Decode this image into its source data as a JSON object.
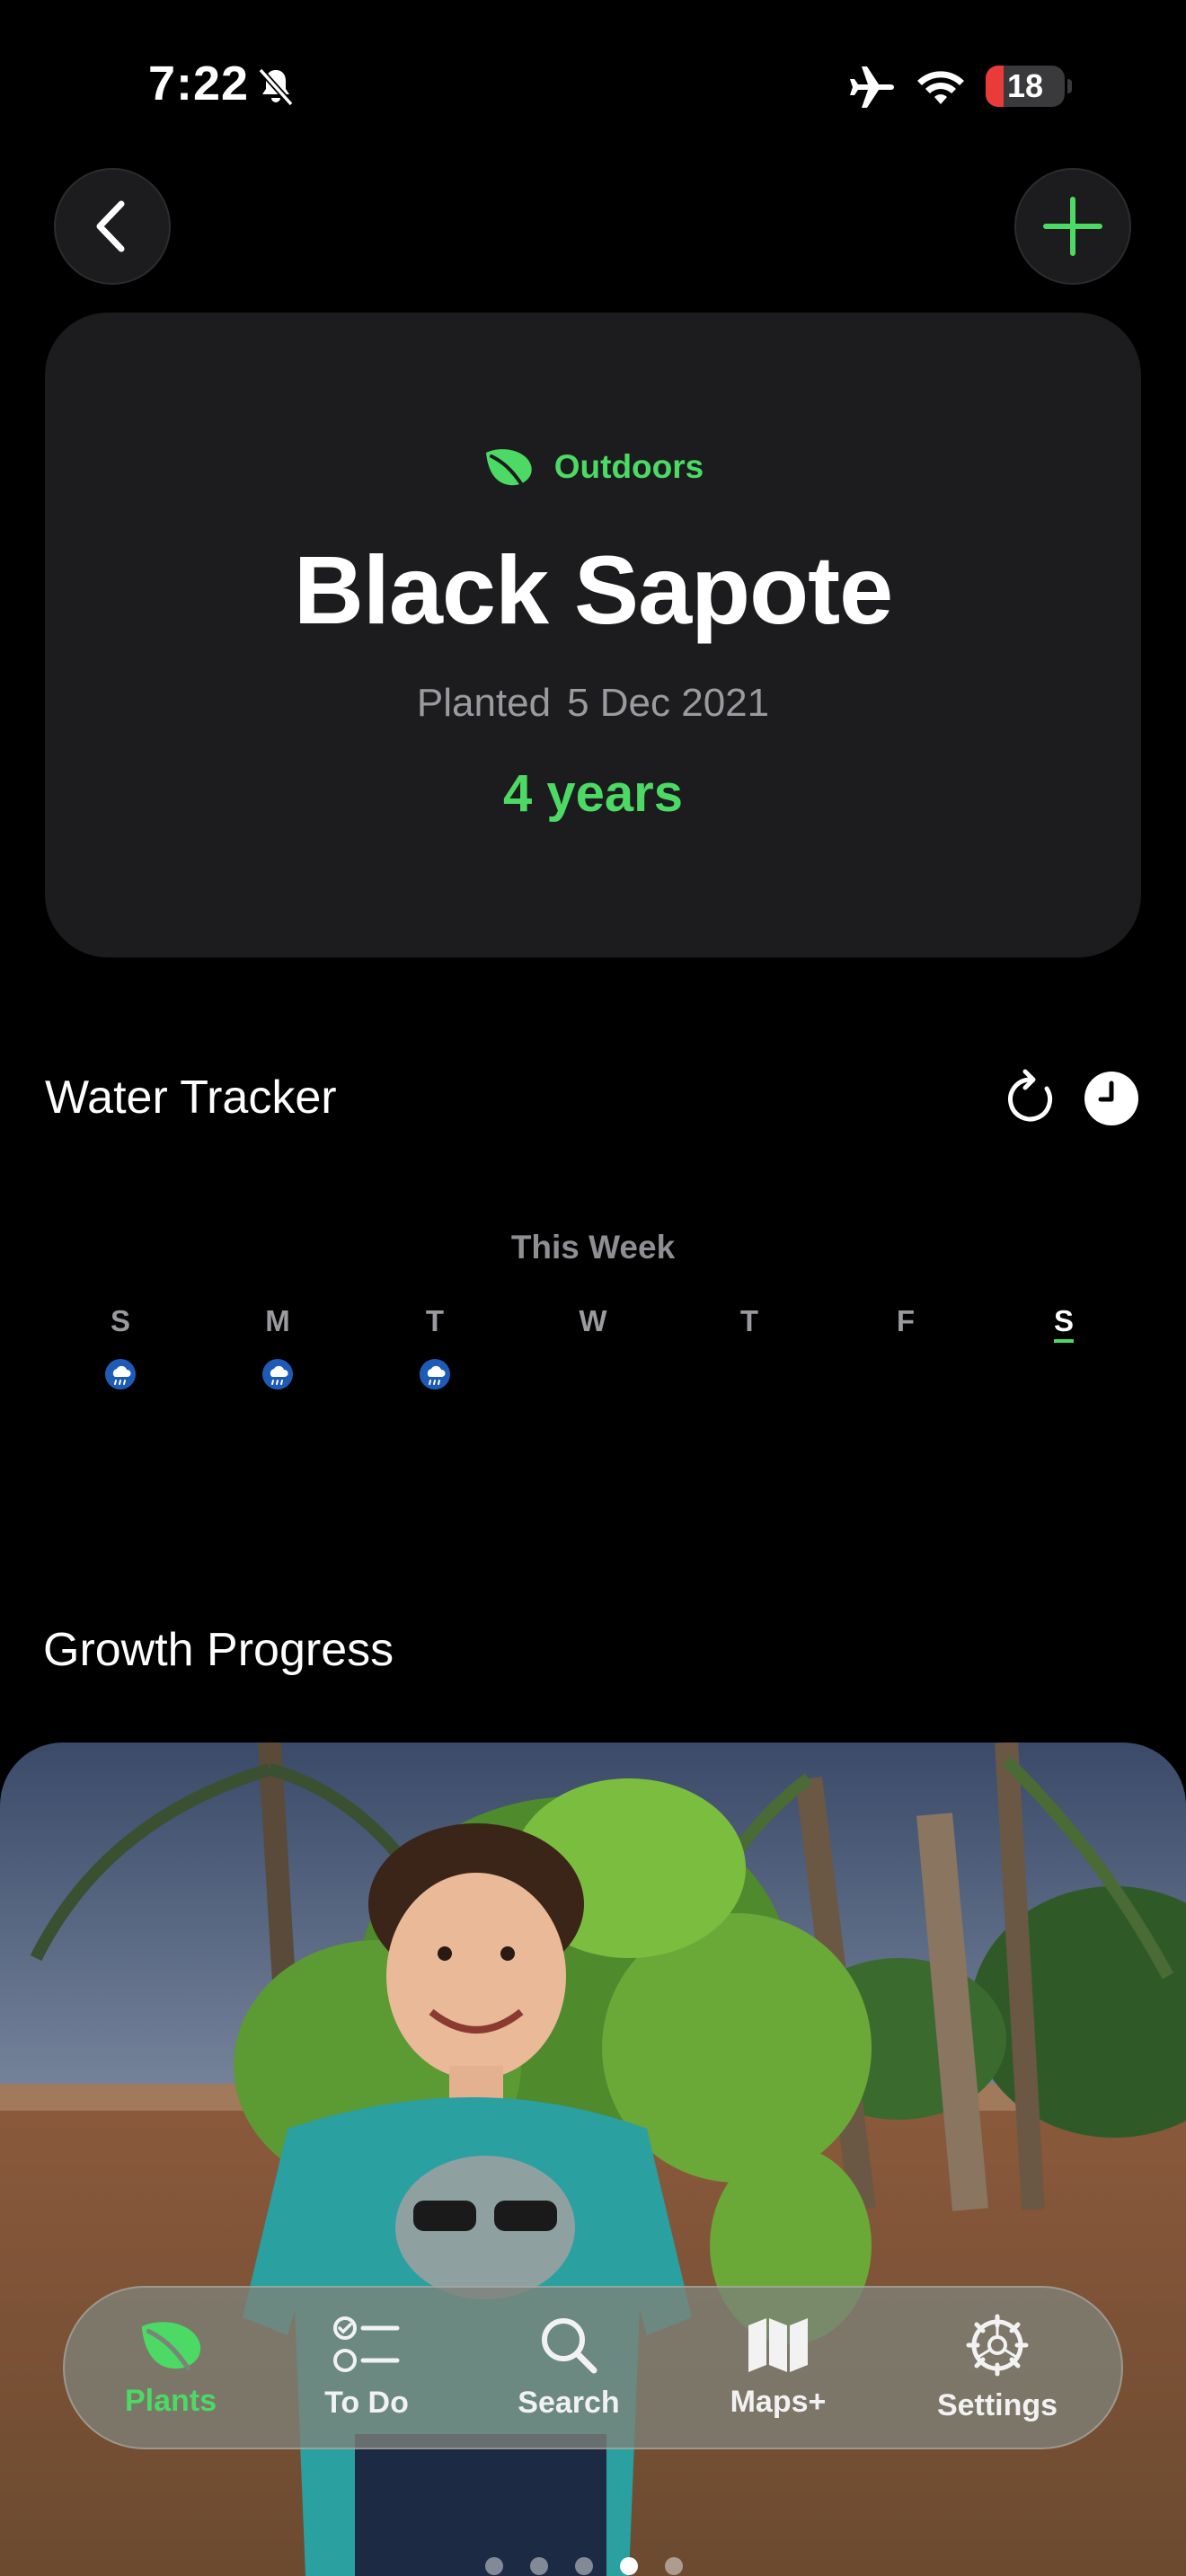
{
  "status_bar": {
    "time": "7:22",
    "battery": "18"
  },
  "header": {
    "location": "Outdoors",
    "plant_name": "Black Sapote",
    "planted_label": "Planted",
    "planted_date": "5 Dec 2021",
    "age": "4 years"
  },
  "water_tracker": {
    "title": "Water Tracker",
    "week_label": "This Week",
    "days": [
      "S",
      "M",
      "T",
      "W",
      "T",
      "F",
      "S"
    ],
    "rain_days": [
      "S",
      "M",
      "T"
    ],
    "today": "S"
  },
  "growth": {
    "title": "Growth Progress"
  },
  "tabbar": {
    "plants": "Plants",
    "todo": "To Do",
    "search": "Search",
    "maps": "Maps+",
    "settings": "Settings"
  },
  "colors": {
    "accent": "#4cd964",
    "card": "#1c1c1e",
    "background": "#000000",
    "battery_low": "#ea3b3b"
  }
}
